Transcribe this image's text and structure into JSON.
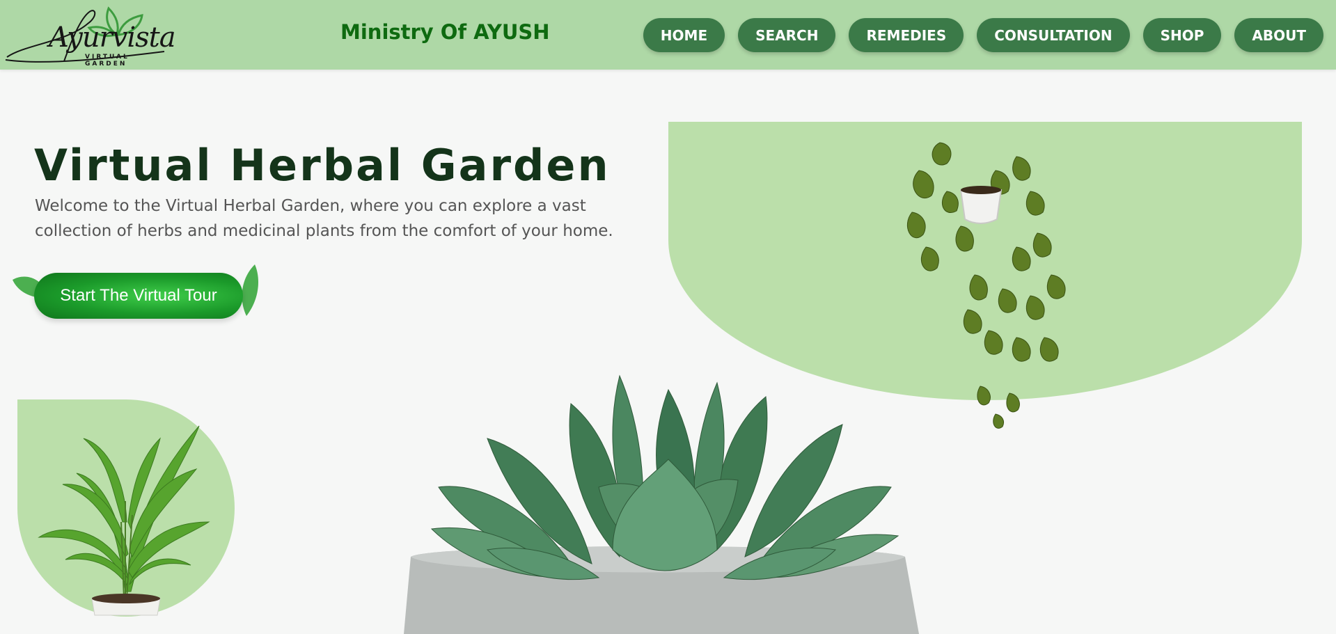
{
  "header": {
    "logo_text": "Ayurvista",
    "logo_subtext": "VIRTUAL GARDEN",
    "title": "Ministry Of AYUSH"
  },
  "nav": {
    "items": [
      {
        "label": "HOME"
      },
      {
        "label": "SEARCH"
      },
      {
        "label": "REMEDIES"
      },
      {
        "label": "CONSULTATION"
      },
      {
        "label": "SHOP"
      },
      {
        "label": "ABOUT"
      }
    ]
  },
  "hero": {
    "title": "Virtual Herbal Garden",
    "description": "Welcome to the Virtual Herbal Garden, where you can explore a vast collection of herbs and medicinal plants from the comfort of your home.",
    "cta_label": "Start The Virtual Tour"
  },
  "colors": {
    "navbar_bg": "#aed8a6",
    "nav_button": "#3b7a48",
    "title_green": "#0e6a10",
    "panel_green": "#bbdfaa",
    "cta_green": "#1b9a2a"
  },
  "icons": {
    "logo": "leaf-logo-icon",
    "hanging_plant": "hanging-pothos-image",
    "potted_plant": "potted-plant-image",
    "succulent": "succulent-pot-image"
  }
}
